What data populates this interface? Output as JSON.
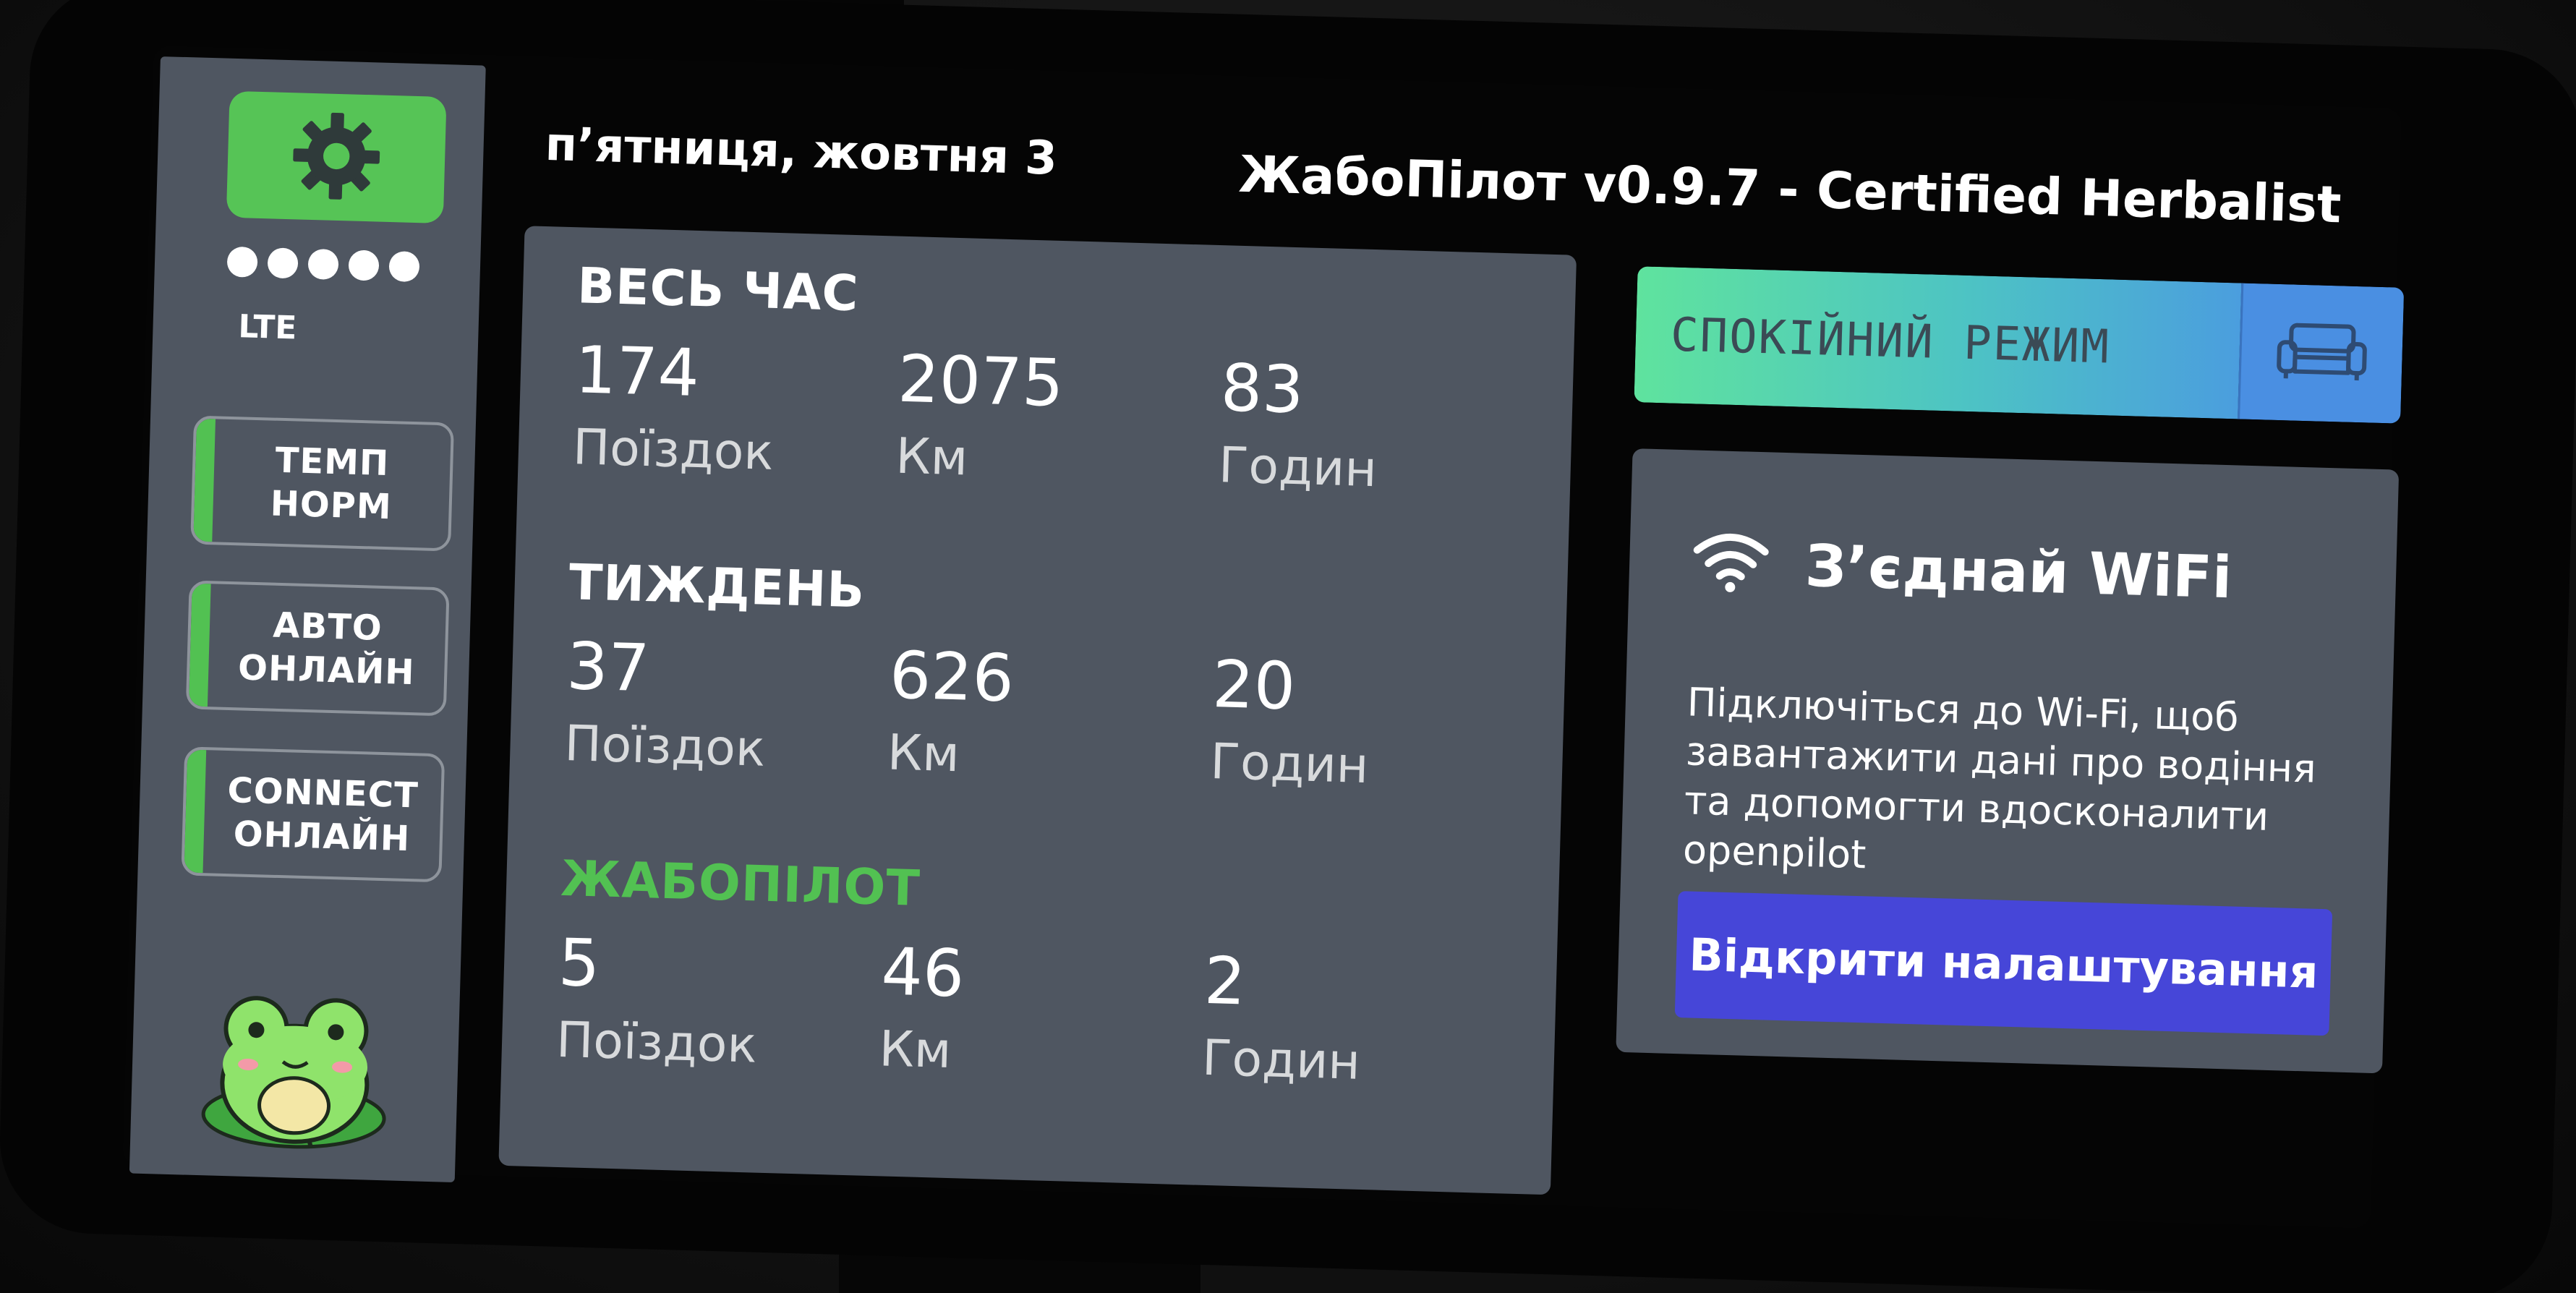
{
  "header": {
    "date": "п’ятниця, жовтня 3",
    "version": "ЖабоПілот v0.9.7 - Certified Herbalist"
  },
  "sidebar": {
    "settings_icon": "gear-icon",
    "signal_bars": 5,
    "network_type": "LTE",
    "statuses": [
      {
        "line1": "ТЕМП",
        "line2": "НОРМ",
        "color": "#52c152"
      },
      {
        "line1": "АВТО",
        "line2": "ОНЛАЙН",
        "color": "#52c152"
      },
      {
        "line1": "CONNECT",
        "line2": "ОНЛАЙН",
        "color": "#52c152"
      }
    ],
    "logo": "frog-logo"
  },
  "stats": {
    "sections": [
      {
        "title": "ВЕСЬ ЧАС",
        "values": [
          {
            "value": "174",
            "unit": "Поїздок"
          },
          {
            "value": "2075",
            "unit": "Км"
          },
          {
            "value": "83",
            "unit": "Годин"
          }
        ]
      },
      {
        "title": "ТИЖДЕНЬ",
        "values": [
          {
            "value": "37",
            "unit": "Поїздок"
          },
          {
            "value": "626",
            "unit": "Км"
          },
          {
            "value": "20",
            "unit": "Годин"
          }
        ]
      },
      {
        "title": "ЖАБОПІЛОТ",
        "values": [
          {
            "value": "5",
            "unit": "Поїздок"
          },
          {
            "value": "46",
            "unit": "Км"
          },
          {
            "value": "2",
            "unit": "Годин"
          }
        ]
      }
    ]
  },
  "mode": {
    "label": "СПОКІЙНИЙ РЕЖИМ",
    "icon": "sofa-icon"
  },
  "wifi_card": {
    "icon": "wifi-icon",
    "title": "З’єднай WiFi",
    "description": "Підключіться до Wi-Fi, щоб завантажити дані про водіння та допомогти вдосконалити openpilot",
    "button_label": "Відкрити налаштування"
  },
  "colors": {
    "accent_green": "#52c152",
    "panel_gray": "#4f5661",
    "button_blue": "#4646d8"
  }
}
